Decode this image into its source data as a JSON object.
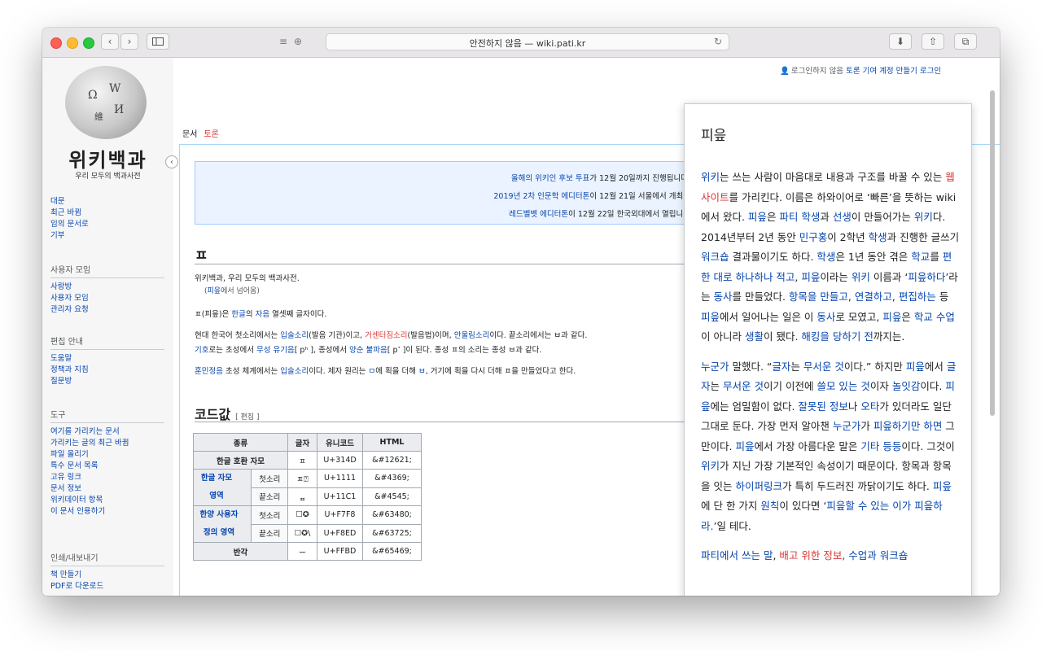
{
  "browser": {
    "address": "안전하지 않음 — wiki.pati.kr"
  },
  "userbar": {
    "not_logged_in": "로그인하지 않음",
    "talk": "토론",
    "contrib": "기여",
    "create": "계정 만들기",
    "login": "로그인"
  },
  "sidebar": {
    "logo_title": "위키백과",
    "logo_sub": "우리 모두의 백과사전",
    "main_links": [
      "대문",
      "최근 바뀜",
      "임의 문서로",
      "기부"
    ],
    "community_head": "사용자 모임",
    "community_links": [
      "사랑방",
      "사용자 모임",
      "관리자 요청"
    ],
    "help_head": "편집 안내",
    "help_links": [
      "도움말",
      "정책과 지침",
      "질문방"
    ],
    "tools_head": "도구",
    "tools_links": [
      "여기를 가리키는 문서",
      "가리키는 글의 최근 바뀜",
      "파일 올리기",
      "특수 문서 목록",
      "고유 링크",
      "문서 정보",
      "위키데이터 항목",
      "이 문서 인용하기"
    ],
    "print_head": "인쇄/내보내기",
    "print_links": [
      "책 만들기",
      "PDF로 다운로드"
    ]
  },
  "tabs": {
    "article": "문서",
    "talk": "토론"
  },
  "notice": {
    "line1_link": "올해의 위키인 후보 투표",
    "line1_text": "가 12월 20일까지 진행됩니다.",
    "line2_link": "2019년 2차 인문학 에디터톤",
    "line2_text": "이 12월 21일 서울에서 개최됩",
    "line3_link": "레드벨벳 에디터톤",
    "line3_text": "이 12월 22일 한국외대에서 열립니다"
  },
  "article": {
    "title": "ㅍ",
    "from": "위키백과, 우리 모두의 백과사전.",
    "redirect_pre": "(",
    "redirect_link": "피읖",
    "redirect_post": "에서 넘어옴)",
    "p1": [
      "ㅍ(피읖)은 ",
      "한글",
      "의 ",
      "자음",
      " 열셋째 글자이다."
    ],
    "p2a": [
      "현대 한국어 첫소리에서는 ",
      "입술소리",
      "(발음 기관)이고, ",
      "거센터짐소리",
      "(발음법)이며, ",
      "안울림소리",
      "이다. 끝소리에서는 ㅂ과 같다."
    ],
    "p2b": [
      "기호",
      "로는 초성에서 ",
      "무성 유기음",
      "[ pʰ ], 종성에서 ",
      "양순 불파음",
      "[ p˺ ]이 된다. 종성 ㅍ의 소리는 종성 ㅂ과 같다."
    ],
    "p3": [
      "훈민정음",
      " 초성 체계에서는 ",
      "입술소리",
      "이다. 제자 원리는 ",
      "ㅁ",
      "에 획을 더해 ",
      "ㅂ",
      ", 거기에 획을 다시 더해 ㅍ을 만들었다고 한다."
    ],
    "section": "코드값",
    "edit": "[ 편집 ]"
  },
  "code_table": {
    "headers": [
      "종류",
      "글자",
      "유니코드",
      "HTML"
    ],
    "rows": [
      {
        "a": "한글 호환 자모",
        "b": "",
        "glyph": "ㅍ",
        "uni": "U+314D",
        "html": "&#12621;"
      },
      {
        "a": "한글 자모 영역",
        "b": "첫소리",
        "glyph": "ㅍ⍰",
        "uni": "U+1111",
        "html": "&#4369;"
      },
      {
        "a": "",
        "b": "끝소리",
        "glyph": "ᇁ",
        "uni": "U+11C1",
        "html": "&#4545;"
      },
      {
        "a": "한양 사용자 정의 영역",
        "b": "첫소리",
        "glyph": "☐✪",
        "uni": "U+F7F8",
        "html": "&#63480;"
      },
      {
        "a": "",
        "b": "끝소리",
        "glyph": "☐✪\\",
        "uni": "U+F8ED",
        "html": "&#63725;"
      },
      {
        "a": "반각",
        "b": "",
        "glyph": "ᅲ",
        "uni": "U+FFBD",
        "html": "&#65469;"
      }
    ]
  },
  "popup": {
    "title": "피읖",
    "para1": [
      [
        "위키",
        "a"
      ],
      [
        "는 쓰는 사람이 마음대로 내용과 구조를 바꿀 수 있는 ",
        ""
      ],
      [
        "웹사이트",
        "new"
      ],
      [
        "를 가리킨다. 이름은 하와이어로 ‘빠른’을 뜻하는 wiki에서 왔다. ",
        ""
      ],
      [
        "피읖",
        "a"
      ],
      [
        "은 ",
        ""
      ],
      [
        "파티 학생",
        "a"
      ],
      [
        "과 ",
        ""
      ],
      [
        "선생",
        "a"
      ],
      [
        "이 만들어가는 ",
        ""
      ],
      [
        "위키",
        "a"
      ],
      [
        "다. 2014년부터 2년 동안 ",
        ""
      ],
      [
        "민구홍",
        "a"
      ],
      [
        "이 2학년 ",
        ""
      ],
      [
        "학생",
        "a"
      ],
      [
        "과 진행한 글쓰기 ",
        ""
      ],
      [
        "워크숍",
        "a"
      ],
      [
        " 결과물이기도 하다. ",
        ""
      ],
      [
        "학생",
        "a"
      ],
      [
        "은 1년 동안 겪은 ",
        ""
      ],
      [
        "학교",
        "a"
      ],
      [
        "를 ",
        ""
      ],
      [
        "편한 대로 하나하나 적고",
        "a"
      ],
      [
        ", ",
        ""
      ],
      [
        "피읖",
        "a"
      ],
      [
        "이라는 ",
        ""
      ],
      [
        "위키",
        "a"
      ],
      [
        " 이름과 ‘",
        ""
      ],
      [
        "피읖하다",
        "a"
      ],
      [
        "’라는 ",
        ""
      ],
      [
        "동사",
        "a"
      ],
      [
        "를 만들었다. ",
        ""
      ],
      [
        "항목을 만들고",
        "a"
      ],
      [
        ", ",
        ""
      ],
      [
        "연결하고",
        "a"
      ],
      [
        ", ",
        ""
      ],
      [
        "편집하는",
        "a"
      ],
      [
        " 등 ",
        ""
      ],
      [
        "피읖",
        "a"
      ],
      [
        "에서 일어나는 일은 이 ",
        ""
      ],
      [
        "동사",
        "a"
      ],
      [
        "로 모였고, ",
        ""
      ],
      [
        "피읖",
        "a"
      ],
      [
        "은 ",
        ""
      ],
      [
        "학교 수업",
        "a"
      ],
      [
        "이 아니라 ",
        ""
      ],
      [
        "생활",
        "a"
      ],
      [
        "이 됐다. ",
        ""
      ],
      [
        "해킹을 당하기 전",
        "a"
      ],
      [
        "까지는.",
        ""
      ]
    ],
    "para2": [
      [
        "누군가",
        "a"
      ],
      [
        " 말했다. “",
        ""
      ],
      [
        "글자",
        "a"
      ],
      [
        "는 ",
        ""
      ],
      [
        "무서운 것",
        "a"
      ],
      [
        "이다.” 하지만 ",
        ""
      ],
      [
        "피읖",
        "a"
      ],
      [
        "에서 ",
        ""
      ],
      [
        "글자",
        "a"
      ],
      [
        "는 ",
        ""
      ],
      [
        "무서운 것",
        "a"
      ],
      [
        "이기 이전에 ",
        ""
      ],
      [
        "쓸모 있는 것",
        "a"
      ],
      [
        "이자 ",
        ""
      ],
      [
        "놀잇감",
        "a"
      ],
      [
        "이다. ",
        ""
      ],
      [
        "피읖",
        "a"
      ],
      [
        "에는 엄밀함이 없다. ",
        ""
      ],
      [
        "잘못된 정보",
        "a"
      ],
      [
        "나 ",
        ""
      ],
      [
        "오타",
        "a"
      ],
      [
        "가 있더라도 일단 그대로 둔다. 가장 먼저 알아챈 ",
        ""
      ],
      [
        "누군가",
        "a"
      ],
      [
        "가 ",
        ""
      ],
      [
        "피읖하기만 하면",
        "a"
      ],
      [
        " 그만이다. ",
        ""
      ],
      [
        "피읖",
        "a"
      ],
      [
        "에서 가장 아름다운 말은 ",
        ""
      ],
      [
        "기타 등등",
        "a"
      ],
      [
        "이다. 그것이 ",
        ""
      ],
      [
        "위키",
        "a"
      ],
      [
        "가 지닌 가장 기본적인 속성이기 때문이다. 항목과 항목을 잇는 ",
        ""
      ],
      [
        "하이퍼링크",
        "a"
      ],
      [
        "가 특히 두드러진 까닭이기도 하다. ",
        ""
      ],
      [
        "피읖",
        "a"
      ],
      [
        "에 단 한 가지 ",
        ""
      ],
      [
        "원칙",
        "a"
      ],
      [
        "이 있다면 ‘",
        ""
      ],
      [
        "피읖할 수 있는 이가 피읖하라.",
        "a"
      ],
      [
        "’일 테다.",
        ""
      ]
    ],
    "para3": [
      [
        "파티에서 쓰는 말",
        "a"
      ],
      [
        ", ",
        ""
      ],
      [
        "배고 위한 정보",
        "new"
      ],
      [
        ", 수업과 워크숍",
        "a"
      ]
    ]
  }
}
